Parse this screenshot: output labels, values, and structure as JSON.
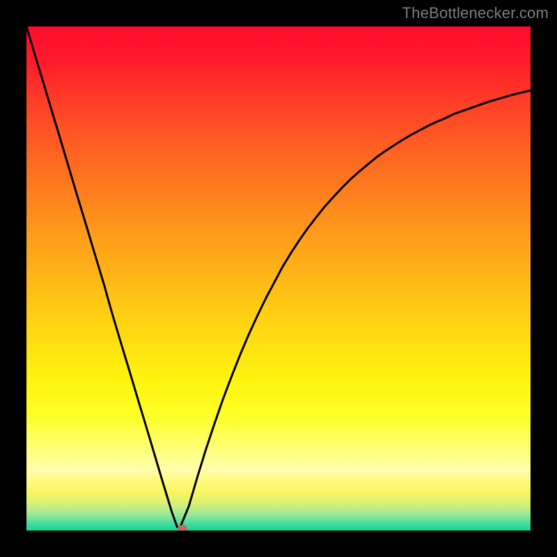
{
  "watermark": "TheBottlenecker.com",
  "chart_data": {
    "type": "line",
    "title": "",
    "xlabel": "",
    "ylabel": "",
    "xlim": [
      0,
      1
    ],
    "ylim": [
      0,
      1
    ],
    "x": [
      0.0,
      0.017,
      0.034,
      0.051,
      0.068,
      0.085,
      0.102,
      0.119,
      0.136,
      0.153,
      0.169,
      0.186,
      0.203,
      0.22,
      0.237,
      0.254,
      0.271,
      0.288,
      0.299,
      0.305,
      0.322,
      0.339,
      0.356,
      0.373,
      0.39,
      0.407,
      0.424,
      0.441,
      0.458,
      0.475,
      0.492,
      0.508,
      0.525,
      0.542,
      0.559,
      0.576,
      0.593,
      0.61,
      0.627,
      0.644,
      0.661,
      0.678,
      0.695,
      0.712,
      0.729,
      0.746,
      0.763,
      0.78,
      0.797,
      0.814,
      0.831,
      0.847,
      0.864,
      0.881,
      0.898,
      0.915,
      0.932,
      0.949,
      0.966,
      0.983,
      1.0
    ],
    "values": [
      1.0,
      0.943,
      0.887,
      0.83,
      0.774,
      0.717,
      0.66,
      0.604,
      0.547,
      0.491,
      0.434,
      0.377,
      0.321,
      0.264,
      0.208,
      0.151,
      0.094,
      0.038,
      0.0,
      0.0,
      0.048,
      0.106,
      0.161,
      0.212,
      0.261,
      0.306,
      0.349,
      0.389,
      0.426,
      0.461,
      0.493,
      0.523,
      0.551,
      0.577,
      0.601,
      0.623,
      0.644,
      0.663,
      0.681,
      0.698,
      0.713,
      0.727,
      0.741,
      0.753,
      0.764,
      0.775,
      0.785,
      0.794,
      0.803,
      0.811,
      0.818,
      0.826,
      0.832,
      0.838,
      0.844,
      0.85,
      0.855,
      0.86,
      0.865,
      0.869,
      0.873
    ],
    "marker": {
      "x": 0.31,
      "y": 0.0
    },
    "bands": [
      {
        "stop": 0.0,
        "color": "#ff0b2d"
      },
      {
        "stop": 0.07,
        "color": "#ff1b2b"
      },
      {
        "stop": 0.14,
        "color": "#ff3a28"
      },
      {
        "stop": 0.21,
        "color": "#ff5524"
      },
      {
        "stop": 0.28,
        "color": "#ff6e20"
      },
      {
        "stop": 0.35,
        "color": "#ff861d"
      },
      {
        "stop": 0.42,
        "color": "#ff9e1a"
      },
      {
        "stop": 0.49,
        "color": "#ffb417"
      },
      {
        "stop": 0.56,
        "color": "#ffcb14"
      },
      {
        "stop": 0.63,
        "color": "#ffe011"
      },
      {
        "stop": 0.7,
        "color": "#fff30f"
      },
      {
        "stop": 0.77,
        "color": "#fdff24"
      },
      {
        "stop": 0.835,
        "color": "#feff73"
      },
      {
        "stop": 0.88,
        "color": "#ffffad"
      },
      {
        "stop": 0.905,
        "color": "#fffa78"
      },
      {
        "stop": 0.925,
        "color": "#f8f561"
      },
      {
        "stop": 0.945,
        "color": "#d8f275"
      },
      {
        "stop": 0.962,
        "color": "#aeeb8d"
      },
      {
        "stop": 0.976,
        "color": "#76e39e"
      },
      {
        "stop": 0.988,
        "color": "#3fdc9d"
      },
      {
        "stop": 1.0,
        "color": "#13d893"
      }
    ]
  }
}
